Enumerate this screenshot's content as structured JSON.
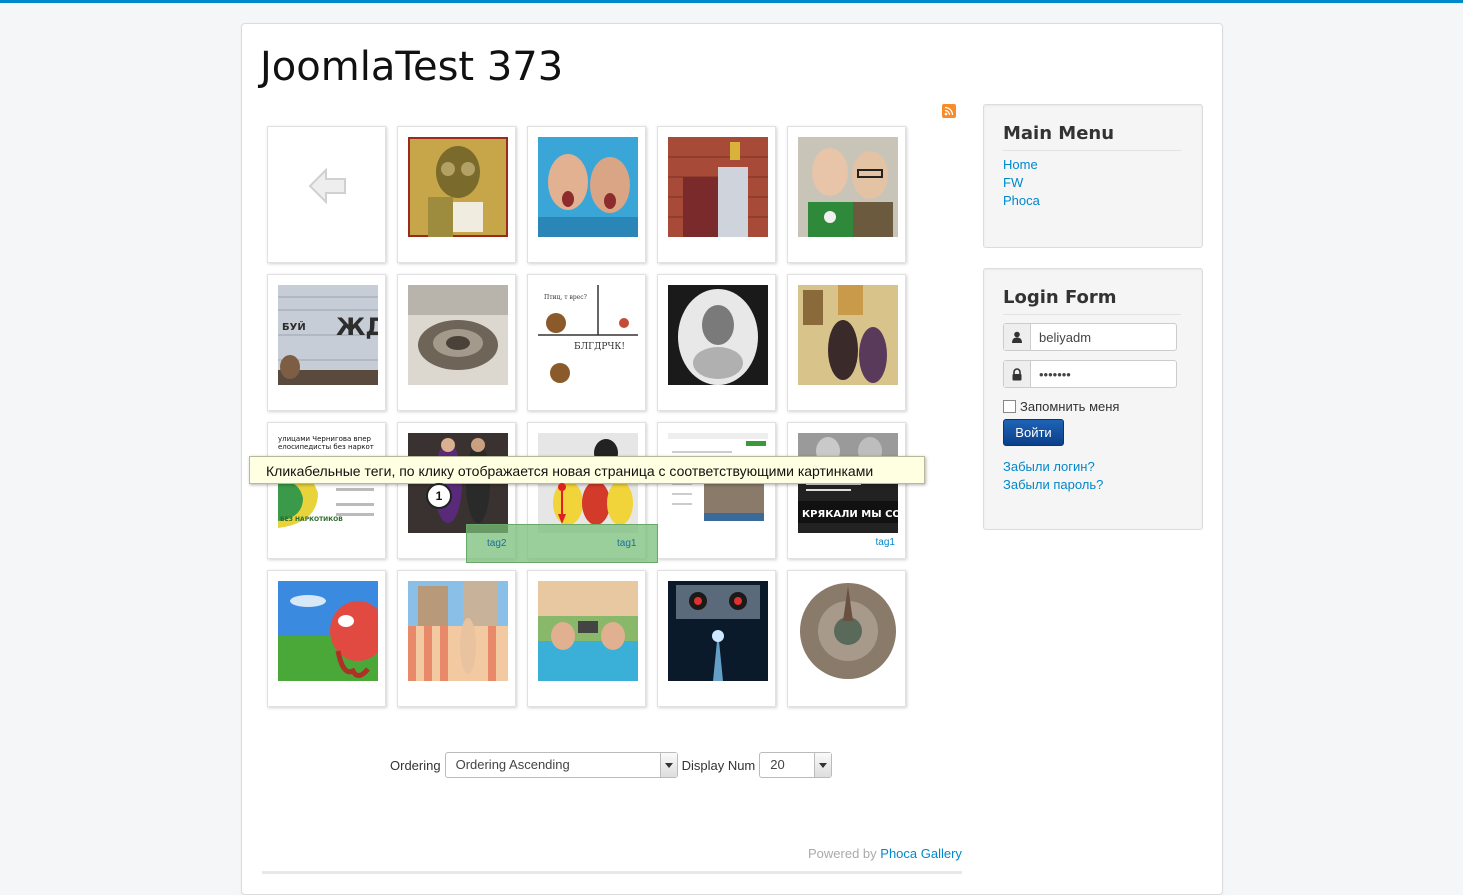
{
  "site": {
    "title": "JoomlaTest 373"
  },
  "gallery": {
    "tooltip": "Кликабельные теги, по клику отображается новая страница с соответствующими картинками",
    "marker": "1",
    "tags": {
      "tag2": "tag2",
      "tag1": "tag1",
      "tag1_right": "tag1"
    },
    "ordering_label": "Ordering",
    "ordering_value": "Ordering Ascending",
    "display_num_label": "Display Num",
    "display_num_value": "20",
    "powered_prefix": "Powered by",
    "powered_link": "Phoca Gallery",
    "thumb_texts": {
      "t6a": "ЖДИ",
      "t6b": "БУЙ",
      "t8a": "Птиц, т врес?",
      "t8b": "БЛГДРЧК!",
      "t11a": "улицами Чернигова впер",
      "t11b": "елосипедисты без наркот",
      "t11c": "БЕЗ НАРКОТИКОВ",
      "t15": "КРЯКАЛИ МЫ СОФТ"
    }
  },
  "main_menu": {
    "title": "Main Menu",
    "items": [
      "Home",
      "FW",
      "Phoca"
    ]
  },
  "login": {
    "title": "Login Form",
    "username": "beliyadm",
    "password": "•••••••",
    "remember": "Запомнить меня",
    "submit": "Войти",
    "forgot_login": "Забыли логин?",
    "forgot_password": "Забыли пароль?"
  },
  "icons": [
    "rss-icon",
    "back-arrow-icon",
    "user-icon",
    "lock-icon",
    "chevron-down-icon",
    "map-pin-icon"
  ]
}
